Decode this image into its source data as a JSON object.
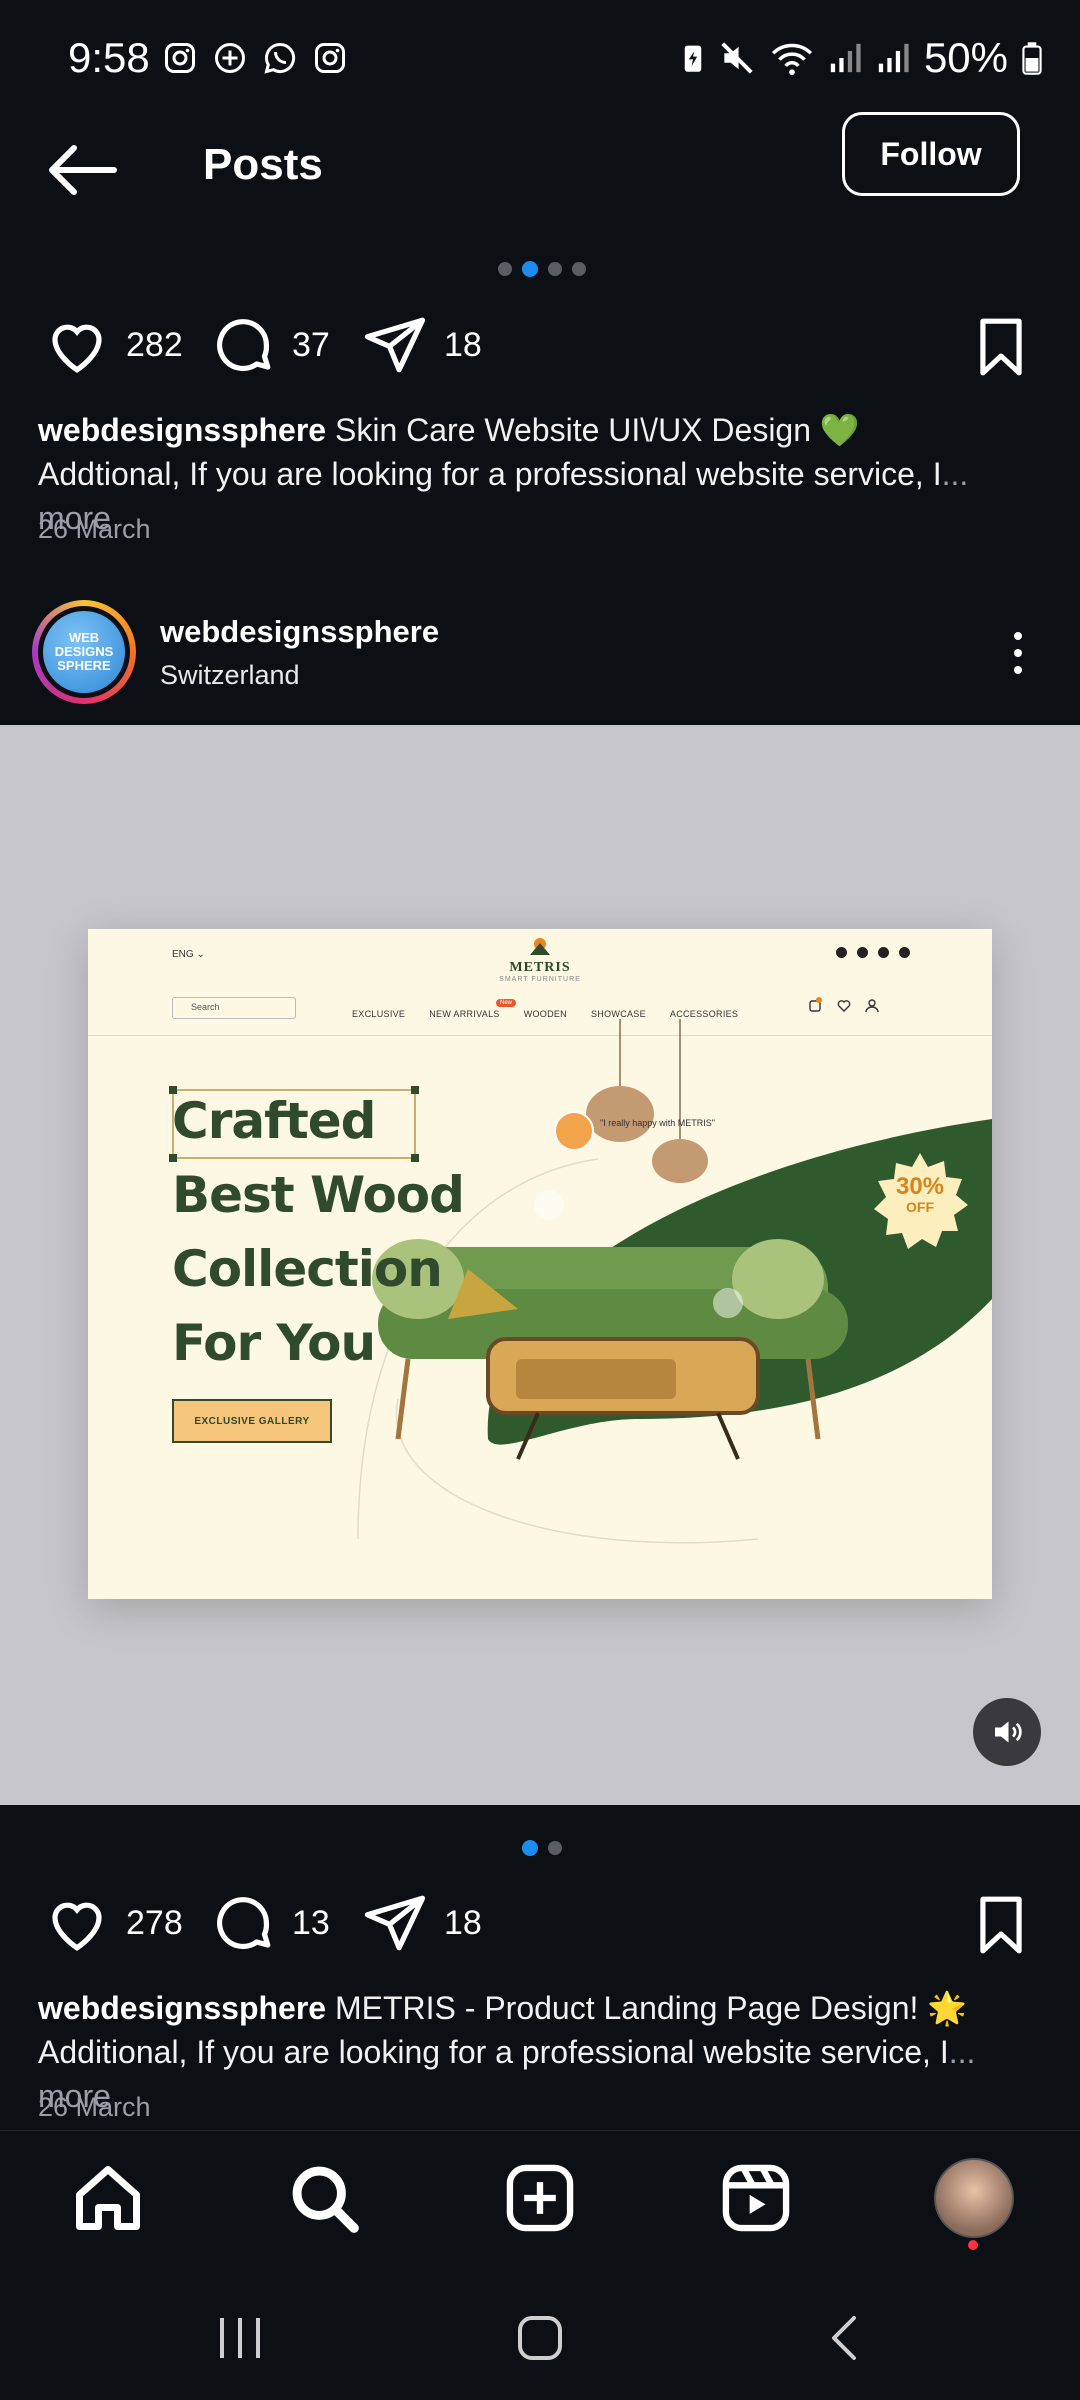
{
  "status_bar": {
    "time": "9:58",
    "battery": "50%",
    "icons": [
      "instagram-icon",
      "threads-icon",
      "whatsapp-icon",
      "instagram-icon"
    ],
    "right_icons": [
      "battery-saver-icon",
      "mute-icon",
      "wifi-icon",
      "signal-icon",
      "signal-icon",
      "battery-icon"
    ]
  },
  "header": {
    "title": "Posts",
    "follow_label": "Follow"
  },
  "post1": {
    "carousel_count": 4,
    "carousel_active": 1,
    "likes": "282",
    "comments": "37",
    "shares": "18",
    "username": "webdesignssphere",
    "caption_title": " Skin Care Website UI\\/UX Design 💚",
    "caption_body": "Addtional, If you are looking for a professional website service, I",
    "more_label": "... more",
    "date": "26 March"
  },
  "post2": {
    "username": "webdesignssphere",
    "location": "Switzerland",
    "avatar_text": "WEB DESIGNS SPHERE",
    "media": {
      "lang": "ENG",
      "brand": "METRIS",
      "brand_sub": "SMART FURNITURE",
      "search_placeholder": "Search",
      "nav": [
        "EXCLUSIVE",
        "NEW ARRIVALS",
        "WOODEN",
        "SHOWCASE",
        "ACCESSORIES"
      ],
      "new_badge": "New",
      "headline": [
        "Crafted",
        "Best Wood",
        "Collection",
        "For You"
      ],
      "cta": "EXCLUSIVE GALLERY",
      "quote": "\"I really happy with METRIS\"",
      "discount": "30%",
      "discount_sub": "OFF",
      "accent_color": "#2f5a2e",
      "cta_color": "#f4c57a"
    },
    "carousel_count": 2,
    "carousel_active": 0,
    "likes": "278",
    "comments": "13",
    "shares": "18",
    "caption_title": " METRIS - Product Landing Page Design! 🌟",
    "caption_body": "Additional, If you are looking for a professional website service, I",
    "more_label": "... more",
    "date": "26 March"
  },
  "bottom_nav": [
    "home-icon",
    "search-icon",
    "create-icon",
    "reels-icon",
    "profile-avatar"
  ],
  "system_nav": [
    "recents-icon",
    "home-button-icon",
    "back-icon"
  ]
}
